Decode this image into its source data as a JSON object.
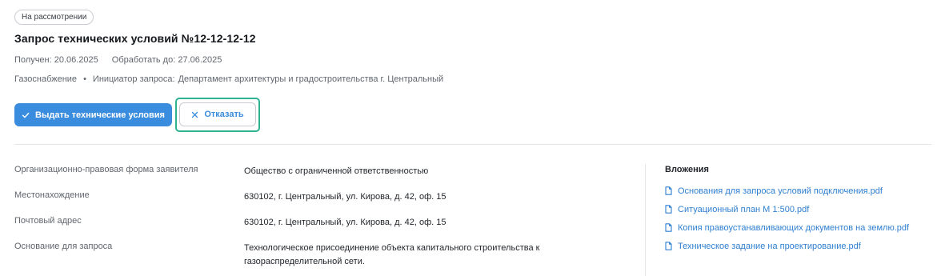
{
  "status": "На рассмотрении",
  "title": "Запрос технических условий №12-12-12-12",
  "meta": {
    "received": "Получен: 20.06.2025",
    "deadline": "Обработать до: 27.06.2025",
    "category": "Газоснабжение",
    "separator": "•",
    "initiator_label": "Инициатор запроса:",
    "initiator_value": "Департамент архитектуры и градостроительства г. Центральный"
  },
  "actions": {
    "issue_label": "Выдать технические условия",
    "issue_icon": "check-icon",
    "reject_label": "Отказать",
    "reject_icon": "close-icon",
    "primary_color": "#3a8dde",
    "focus_color": "#2db391"
  },
  "details": [
    {
      "label": "Организационно-правовая форма заявителя",
      "value": "Общество с ограниченной ответственностью"
    },
    {
      "label": "Местонахождение",
      "value": "630102, г. Центральный, ул. Кирова, д. 42, оф. 15"
    },
    {
      "label": "Почтовый адрес",
      "value": "630102, г. Центральный, ул. Кирова, д. 42, оф. 15"
    },
    {
      "label": "Основание для запроса",
      "value": "Технологическое присоединение объекта капитального строительства к газораспределительной сети."
    }
  ],
  "attachments": {
    "title": "Вложения",
    "icon": "file-icon",
    "link_color": "#2f7fd0",
    "items": [
      "Основания для запроса условий подключения.pdf",
      "Ситуационный план М 1:500.pdf",
      "Копия правоустанавливающих документов на землю.pdf",
      "Техническое задание на проектирование.pdf"
    ]
  }
}
